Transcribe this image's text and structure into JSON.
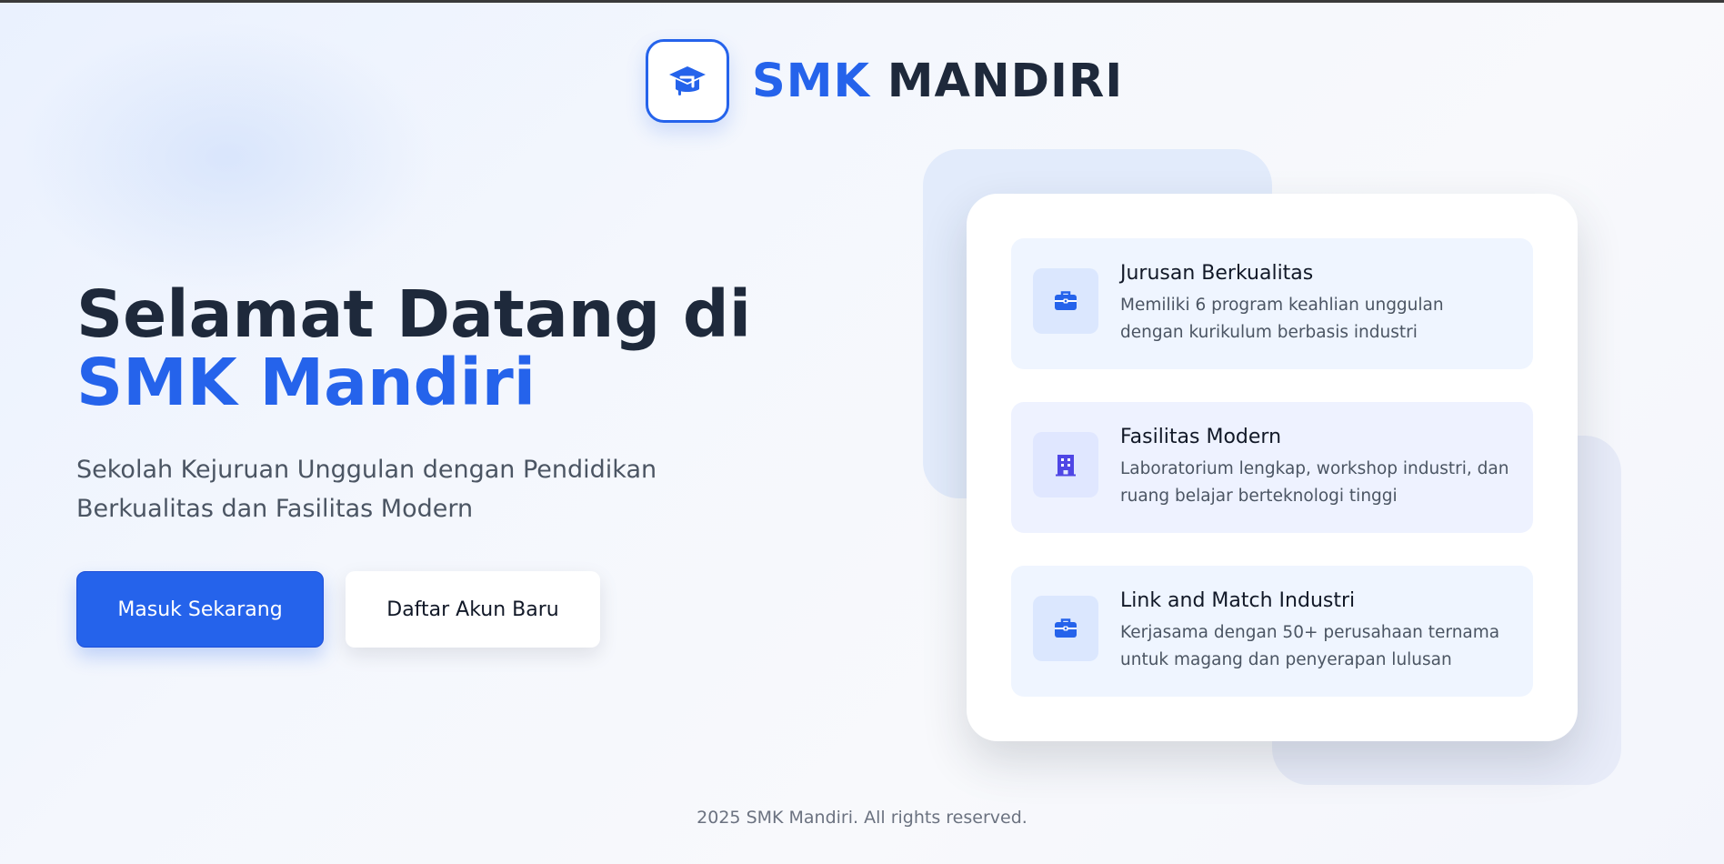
{
  "brand": {
    "name_accent": "SMK",
    "name_rest": "MANDIRI",
    "logo_icon": "graduation-cap-icon"
  },
  "hero": {
    "title_prefix": "Selamat Datang di ",
    "title_accent": "SMK Mandiri",
    "subtitle": "Sekolah Kejuruan Unggulan dengan Pendidikan Berkualitas dan Fasilitas Modern"
  },
  "actions": {
    "login_label": "Masuk Sekarang",
    "register_label": "Daftar Akun Baru"
  },
  "features": [
    {
      "icon": "briefcase-icon",
      "title": "Jurusan Berkualitas",
      "description": "Memiliki 6 program keahlian unggulan dengan kurikulum berbasis industri"
    },
    {
      "icon": "building-icon",
      "title": "Fasilitas Modern",
      "description": "Laboratorium lengkap, workshop industri, dan ruang belajar berteknologi tinggi"
    },
    {
      "icon": "briefcase-icon",
      "title": "Link and Match Industri",
      "description": "Kerjasama dengan 50+ perusahaan ternama untuk magang dan penyerapan lulusan"
    }
  ],
  "footer": {
    "copyright": "2025 SMK Mandiri. All rights reserved."
  },
  "colors": {
    "accent": "#2563eb",
    "heading": "#1e293b",
    "text_muted": "#4b5563",
    "building_icon": "#4f46e5"
  }
}
